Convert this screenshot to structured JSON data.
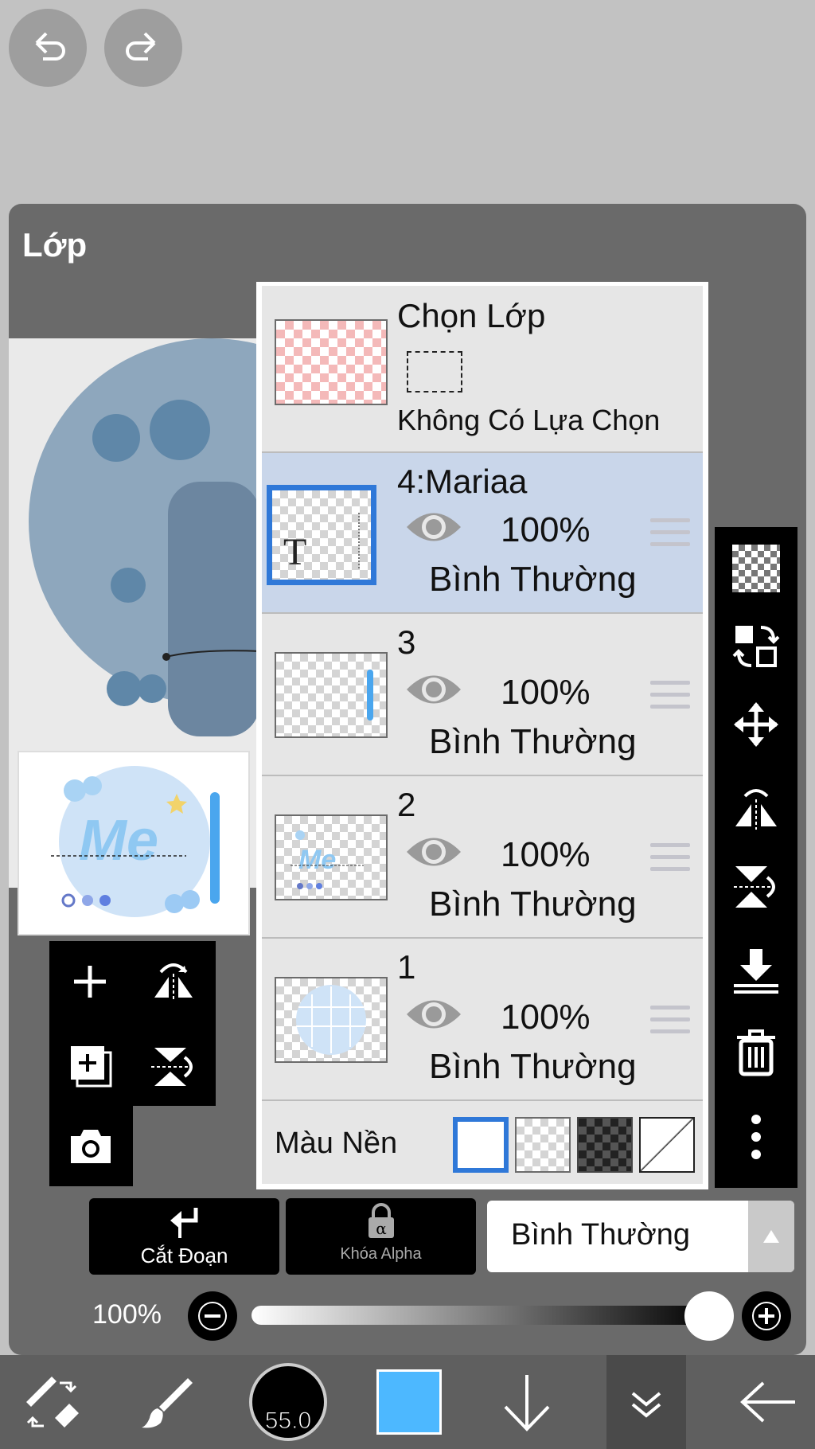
{
  "panel": {
    "title": "Lớp"
  },
  "selection_row": {
    "title": "Chọn Lớp",
    "subtitle": "Không Có Lựa Chọn"
  },
  "layers": [
    {
      "name": "4:Mariaa",
      "opacity": "100%",
      "mode": "Bình Thường"
    },
    {
      "name": "3",
      "opacity": "100%",
      "mode": "Bình Thường"
    },
    {
      "name": "2",
      "opacity": "100%",
      "mode": "Bình Thường"
    },
    {
      "name": "1",
      "opacity": "100%",
      "mode": "Bình Thường"
    }
  ],
  "background": {
    "label": "Màu Nền"
  },
  "actions": {
    "clip_label": "Cắt Đoạn",
    "alpha_lock_label": "Khóa Alpha",
    "blend_mode": "Bình Thường"
  },
  "opacity_slider": {
    "label": "100%",
    "value": 1.0
  },
  "brush_size": "55.0",
  "colors": {
    "accent": "#2f78d8",
    "current_color": "#4db8ff",
    "selected_row": "#c9d6ea"
  }
}
